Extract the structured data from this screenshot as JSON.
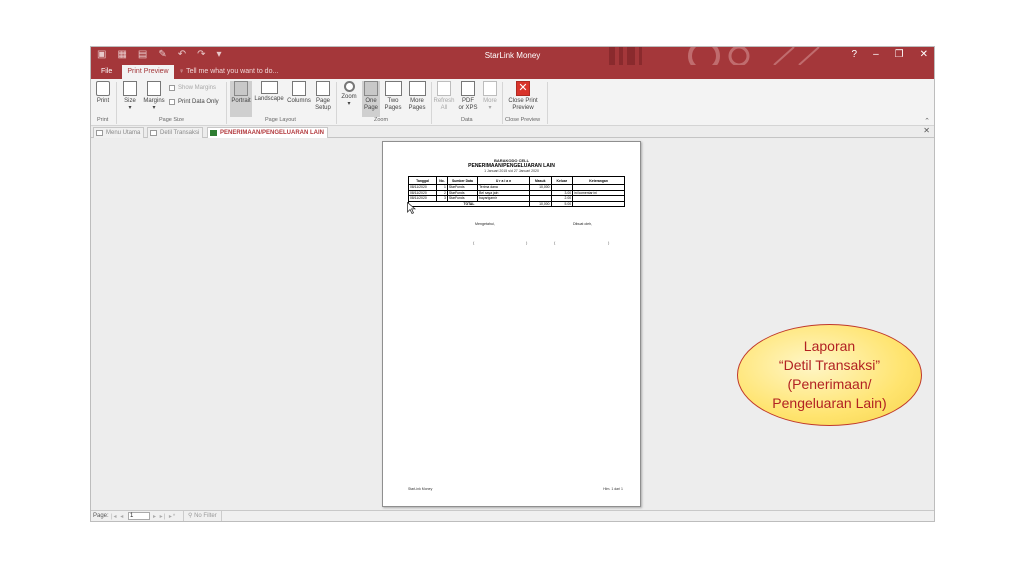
{
  "window": {
    "title": "StarLink Money",
    "help": "?",
    "minimize": "–",
    "restore": "❐",
    "close": "✕"
  },
  "tabs": {
    "file": "File",
    "print_preview": "Print Preview",
    "tell_me": "Tell me what you want to do..."
  },
  "ribbon": {
    "print": "Print",
    "size": "Size",
    "margins": "Margins",
    "show_margins": "Show Margins",
    "print_data_only": "Print Data Only",
    "portrait": "Portrait",
    "landscape": "Landscape",
    "columns": "Columns",
    "page_setup_1": "Page",
    "page_setup_2": "Setup",
    "zoom": "Zoom",
    "one_page_1": "One",
    "one_page_2": "Page",
    "two_pages_1": "Two",
    "two_pages_2": "Pages",
    "more_pages_1": "More",
    "more_pages_2": "Pages",
    "refresh_1": "Refresh",
    "refresh_2": "All",
    "pdf_1": "PDF",
    "pdf_2": "or XPS",
    "more_1": "More",
    "close_1": "Close Print",
    "close_2": "Preview",
    "groups": {
      "print": "Print",
      "page_size": "Page Size",
      "page_layout": "Page Layout",
      "zoom": "Zoom",
      "data": "Data",
      "close_preview": "Close Preview"
    }
  },
  "doc_tabs": {
    "menu_utama": "Menu Utama",
    "detil_transaksi": "Detil Transaksi",
    "penerimaan": "PENERIMAAN/PENGELUARAN LAIN"
  },
  "report": {
    "company": "BARAKODO CELL",
    "title": "PENERIMAAN/PENGELUARAN LAIN",
    "period": "1 Januari 2015 s/d 27 Januari 2020",
    "headers": [
      "Tanggal",
      "No.",
      "Sumber Data",
      "U r a i a n",
      "Masuk",
      "Keluar",
      "Keterangan"
    ],
    "rows": [
      [
        "08/11/2020",
        "1",
        "StarFunds",
        "Terima dana",
        "10,000",
        "",
        ""
      ],
      [
        "08/11/2020",
        "2",
        "StarFunds",
        "Bel saya jaln",
        "",
        "3.00",
        "ini komentar ini"
      ],
      [
        "08/11/2020",
        "3",
        "StarFunds",
        "bayarlgarnir",
        "",
        "2.00",
        ""
      ]
    ],
    "total_label": "TOTAL",
    "total_in": "10,000",
    "total_out": "5.00",
    "sig_left": "Mengetahui,",
    "sig_right": "Dibuat oleh,",
    "sig_dot": "(",
    "sig_dot_r": ")",
    "footer_left": "StarLink Money",
    "footer_right": "Hlm. 1 dari 1"
  },
  "status": {
    "page_label": "Page:",
    "nav_first": "|◂ ◂",
    "page_value": "1",
    "nav_last": "▸ ▸| ▸*",
    "filter": "No Filter"
  },
  "annotation": {
    "line1": "Laporan",
    "line2": "“Detil Transaksi”",
    "line3": "(Penerimaan/",
    "line4": "Pengeluaran Lain)"
  }
}
